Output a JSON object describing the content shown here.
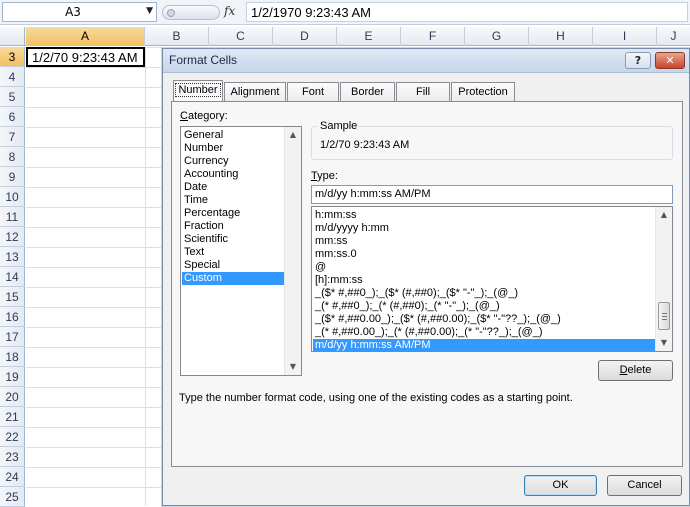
{
  "formula_bar": {
    "name_box": "A3",
    "fx_label": "fx",
    "value": "1/2/1970  9:23:43 AM"
  },
  "sheet": {
    "columns": [
      "A",
      "B",
      "C",
      "D",
      "E",
      "F",
      "G",
      "H",
      "I",
      "J"
    ],
    "selected_column": "A",
    "rows": [
      "3",
      "4",
      "5",
      "6",
      "7",
      "8",
      "9",
      "10",
      "11",
      "12",
      "13",
      "14",
      "15",
      "16",
      "17",
      "18",
      "19",
      "20",
      "21",
      "22",
      "23",
      "24",
      "25"
    ],
    "selected_row": "3",
    "active_cell_value": "1/2/70 9:23:43 AM"
  },
  "dialog": {
    "title": "Format Cells",
    "help_label": "?",
    "close_label": "✕",
    "tabs": [
      "Number",
      "Alignment",
      "Font",
      "Border",
      "Fill",
      "Protection"
    ],
    "active_tab": "Number",
    "category_label_first": "C",
    "category_label_rest": "ategory:",
    "categories": [
      "General",
      "Number",
      "Currency",
      "Accounting",
      "Date",
      "Time",
      "Percentage",
      "Fraction",
      "Scientific",
      "Text",
      "Special",
      "Custom"
    ],
    "selected_category": "Custom",
    "sample_label": "Sample",
    "sample_value": "1/2/70 9:23:43 AM",
    "type_label_first": "T",
    "type_label_rest": "ype:",
    "type_value": "m/d/yy h:mm:ss AM/PM",
    "type_list": [
      "h:mm:ss",
      "m/d/yyyy h:mm",
      "mm:ss",
      "mm:ss.0",
      "@",
      "[h]:mm:ss",
      "_($* #,##0_);_($* (#,##0);_($* \"-\"_);_(@_)",
      "_(* #,##0_);_(* (#,##0);_(* \"-\"_);_(@_)",
      "_($* #,##0.00_);_($* (#,##0.00);_($* \"-\"??_);_(@_)",
      "_(* #,##0.00_);_(* (#,##0.00);_(* \"-\"??_);_(@_)",
      "m/d/yy h:mm:ss AM/PM"
    ],
    "selected_type_index": 10,
    "delete_label_first": "D",
    "delete_label_rest": "elete",
    "description": "Type the number format code, using one of the existing codes as a starting point.",
    "ok_label": "OK",
    "cancel_label": "Cancel"
  }
}
